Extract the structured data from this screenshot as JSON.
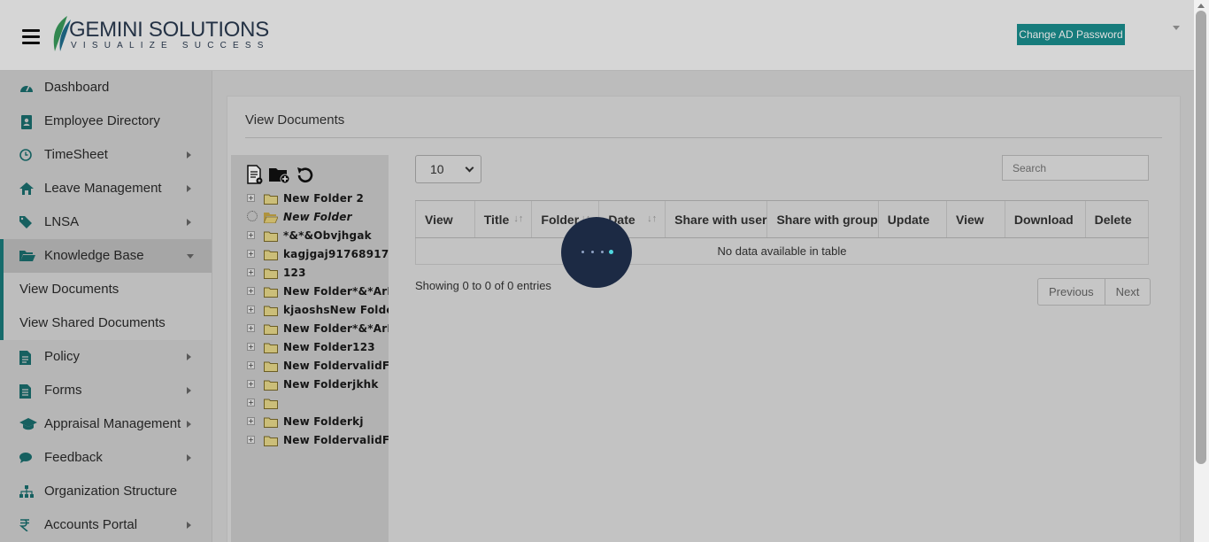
{
  "header": {
    "brand_name": "GEMINI SOLUTIONS",
    "brand_tagline": "VISUALIZE SUCCESS",
    "change_password_label": "Change AD Password"
  },
  "sidebar": {
    "items": [
      {
        "label": "Dashboard",
        "icon": "dashboard-icon",
        "has_arrow": false
      },
      {
        "label": "Employee Directory",
        "icon": "directory-icon",
        "has_arrow": false
      },
      {
        "label": "TimeSheet",
        "icon": "clock-icon",
        "has_arrow": true
      },
      {
        "label": "Leave Management",
        "icon": "home-icon",
        "has_arrow": true
      },
      {
        "label": "LNSA",
        "icon": "tag-icon",
        "has_arrow": true
      },
      {
        "label": "Knowledge Base",
        "icon": "folder-open-icon",
        "has_arrow": true,
        "active": true
      },
      {
        "label": "Policy",
        "icon": "document-icon",
        "has_arrow": true
      },
      {
        "label": "Forms",
        "icon": "form-icon",
        "has_arrow": true
      },
      {
        "label": "Appraisal Management",
        "icon": "graduation-cap-icon",
        "has_arrow": true
      },
      {
        "label": "Feedback",
        "icon": "comments-icon",
        "has_arrow": true
      },
      {
        "label": "Organization Structure",
        "icon": "sitemap-icon",
        "has_arrow": false
      },
      {
        "label": "Accounts Portal",
        "icon": "rupee-icon",
        "has_arrow": true
      }
    ],
    "subitems": [
      {
        "label": "View Documents"
      },
      {
        "label": "View Shared Documents"
      }
    ]
  },
  "panel": {
    "title": "View Documents"
  },
  "tree": {
    "folders": [
      {
        "name": "New Folder 2",
        "italic": false,
        "loading": false
      },
      {
        "name": "New Folder",
        "italic": true,
        "loading": true
      },
      {
        "name": "*&*&Obvjhgak",
        "italic": false,
        "loading": false
      },
      {
        "name": "kagjgaj91768917",
        "italic": false,
        "loading": false
      },
      {
        "name": "123",
        "italic": false,
        "loading": false
      },
      {
        "name": "New Folder*&*ArF",
        "italic": false,
        "loading": false
      },
      {
        "name": "kjaoshsNew Folder",
        "italic": false,
        "loading": false
      },
      {
        "name": "New Folder*&*ArF",
        "italic": false,
        "loading": false
      },
      {
        "name": "New Folder123",
        "italic": false,
        "loading": false
      },
      {
        "name": "New FoldervalidFo",
        "italic": false,
        "loading": false
      },
      {
        "name": "New Folderjkhk",
        "italic": false,
        "loading": false
      },
      {
        "name": "",
        "italic": false,
        "loading": false
      },
      {
        "name": "New Folderkj",
        "italic": false,
        "loading": false
      },
      {
        "name": "New FoldervalidFo",
        "italic": false,
        "loading": false
      }
    ]
  },
  "table": {
    "page_length": "10",
    "search_placeholder": "Search",
    "columns": [
      {
        "label": "View",
        "sortable": false
      },
      {
        "label": "Title",
        "sortable": true
      },
      {
        "label": "Folder",
        "sortable": true
      },
      {
        "label": "Date",
        "sortable": true
      },
      {
        "label": "Share with user",
        "sortable": false
      },
      {
        "label": "Share with group",
        "sortable": false
      },
      {
        "label": "Update",
        "sortable": false
      },
      {
        "label": "View",
        "sortable": false
      },
      {
        "label": "Download",
        "sortable": false
      },
      {
        "label": "Delete",
        "sortable": false
      }
    ],
    "empty_message": "No data available in table",
    "info": "Showing 0 to 0 of 0 entries",
    "prev_label": "Previous",
    "next_label": "Next"
  },
  "colors": {
    "accent": "#1a8e8e",
    "loader_bg": "#1c2a44",
    "loader_dot": "#4fd8e0"
  }
}
